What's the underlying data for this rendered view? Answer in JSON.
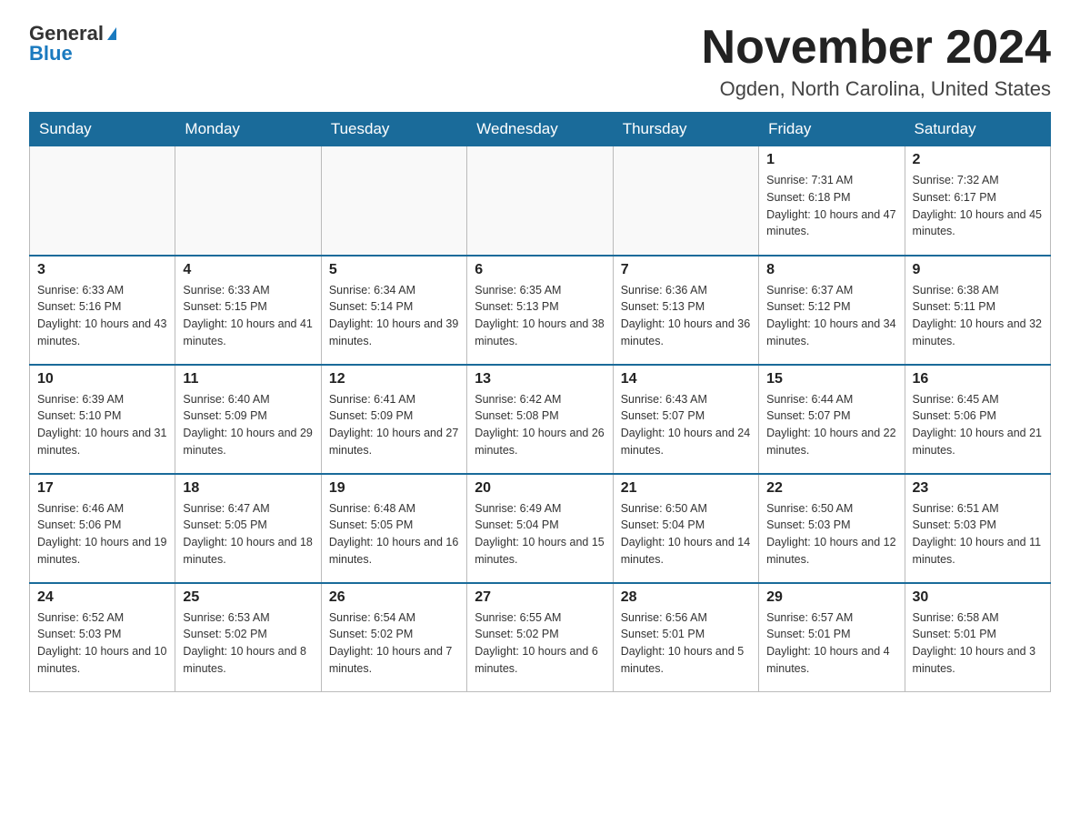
{
  "logo": {
    "general": "General",
    "triangle": "",
    "blue": "Blue"
  },
  "title": "November 2024",
  "subtitle": "Ogden, North Carolina, United States",
  "days_of_week": [
    "Sunday",
    "Monday",
    "Tuesday",
    "Wednesday",
    "Thursday",
    "Friday",
    "Saturday"
  ],
  "weeks": [
    [
      {
        "day": "",
        "info": ""
      },
      {
        "day": "",
        "info": ""
      },
      {
        "day": "",
        "info": ""
      },
      {
        "day": "",
        "info": ""
      },
      {
        "day": "",
        "info": ""
      },
      {
        "day": "1",
        "info": "Sunrise: 7:31 AM\nSunset: 6:18 PM\nDaylight: 10 hours and 47 minutes."
      },
      {
        "day": "2",
        "info": "Sunrise: 7:32 AM\nSunset: 6:17 PM\nDaylight: 10 hours and 45 minutes."
      }
    ],
    [
      {
        "day": "3",
        "info": "Sunrise: 6:33 AM\nSunset: 5:16 PM\nDaylight: 10 hours and 43 minutes."
      },
      {
        "day": "4",
        "info": "Sunrise: 6:33 AM\nSunset: 5:15 PM\nDaylight: 10 hours and 41 minutes."
      },
      {
        "day": "5",
        "info": "Sunrise: 6:34 AM\nSunset: 5:14 PM\nDaylight: 10 hours and 39 minutes."
      },
      {
        "day": "6",
        "info": "Sunrise: 6:35 AM\nSunset: 5:13 PM\nDaylight: 10 hours and 38 minutes."
      },
      {
        "day": "7",
        "info": "Sunrise: 6:36 AM\nSunset: 5:13 PM\nDaylight: 10 hours and 36 minutes."
      },
      {
        "day": "8",
        "info": "Sunrise: 6:37 AM\nSunset: 5:12 PM\nDaylight: 10 hours and 34 minutes."
      },
      {
        "day": "9",
        "info": "Sunrise: 6:38 AM\nSunset: 5:11 PM\nDaylight: 10 hours and 32 minutes."
      }
    ],
    [
      {
        "day": "10",
        "info": "Sunrise: 6:39 AM\nSunset: 5:10 PM\nDaylight: 10 hours and 31 minutes."
      },
      {
        "day": "11",
        "info": "Sunrise: 6:40 AM\nSunset: 5:09 PM\nDaylight: 10 hours and 29 minutes."
      },
      {
        "day": "12",
        "info": "Sunrise: 6:41 AM\nSunset: 5:09 PM\nDaylight: 10 hours and 27 minutes."
      },
      {
        "day": "13",
        "info": "Sunrise: 6:42 AM\nSunset: 5:08 PM\nDaylight: 10 hours and 26 minutes."
      },
      {
        "day": "14",
        "info": "Sunrise: 6:43 AM\nSunset: 5:07 PM\nDaylight: 10 hours and 24 minutes."
      },
      {
        "day": "15",
        "info": "Sunrise: 6:44 AM\nSunset: 5:07 PM\nDaylight: 10 hours and 22 minutes."
      },
      {
        "day": "16",
        "info": "Sunrise: 6:45 AM\nSunset: 5:06 PM\nDaylight: 10 hours and 21 minutes."
      }
    ],
    [
      {
        "day": "17",
        "info": "Sunrise: 6:46 AM\nSunset: 5:06 PM\nDaylight: 10 hours and 19 minutes."
      },
      {
        "day": "18",
        "info": "Sunrise: 6:47 AM\nSunset: 5:05 PM\nDaylight: 10 hours and 18 minutes."
      },
      {
        "day": "19",
        "info": "Sunrise: 6:48 AM\nSunset: 5:05 PM\nDaylight: 10 hours and 16 minutes."
      },
      {
        "day": "20",
        "info": "Sunrise: 6:49 AM\nSunset: 5:04 PM\nDaylight: 10 hours and 15 minutes."
      },
      {
        "day": "21",
        "info": "Sunrise: 6:50 AM\nSunset: 5:04 PM\nDaylight: 10 hours and 14 minutes."
      },
      {
        "day": "22",
        "info": "Sunrise: 6:50 AM\nSunset: 5:03 PM\nDaylight: 10 hours and 12 minutes."
      },
      {
        "day": "23",
        "info": "Sunrise: 6:51 AM\nSunset: 5:03 PM\nDaylight: 10 hours and 11 minutes."
      }
    ],
    [
      {
        "day": "24",
        "info": "Sunrise: 6:52 AM\nSunset: 5:03 PM\nDaylight: 10 hours and 10 minutes."
      },
      {
        "day": "25",
        "info": "Sunrise: 6:53 AM\nSunset: 5:02 PM\nDaylight: 10 hours and 8 minutes."
      },
      {
        "day": "26",
        "info": "Sunrise: 6:54 AM\nSunset: 5:02 PM\nDaylight: 10 hours and 7 minutes."
      },
      {
        "day": "27",
        "info": "Sunrise: 6:55 AM\nSunset: 5:02 PM\nDaylight: 10 hours and 6 minutes."
      },
      {
        "day": "28",
        "info": "Sunrise: 6:56 AM\nSunset: 5:01 PM\nDaylight: 10 hours and 5 minutes."
      },
      {
        "day": "29",
        "info": "Sunrise: 6:57 AM\nSunset: 5:01 PM\nDaylight: 10 hours and 4 minutes."
      },
      {
        "day": "30",
        "info": "Sunrise: 6:58 AM\nSunset: 5:01 PM\nDaylight: 10 hours and 3 minutes."
      }
    ]
  ]
}
